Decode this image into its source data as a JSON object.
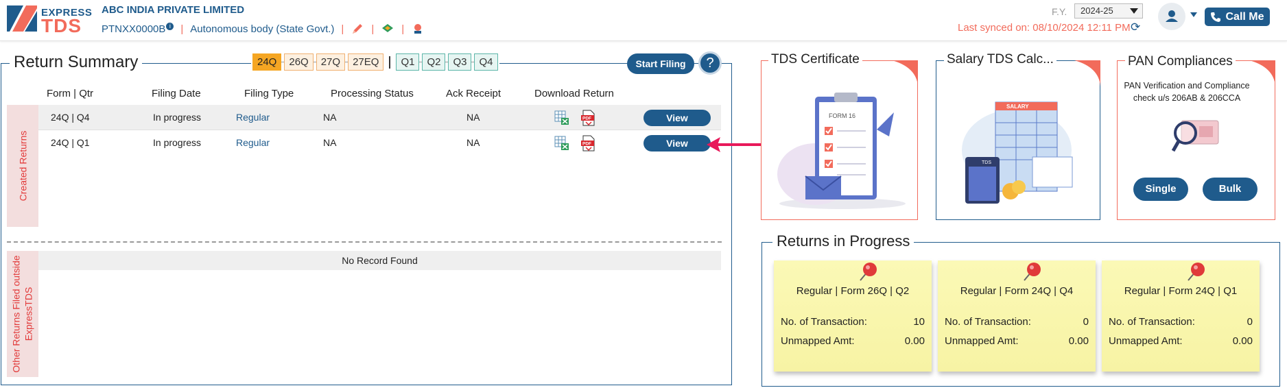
{
  "header": {
    "logo_top": "EXPRESS",
    "logo_bottom": "TDS",
    "company_name": "ABC INDIA PRIVATE LIMITED",
    "pan": "PTNXX0000B",
    "entity_type": "Autonomous body (State Govt.)",
    "fy_label": "F.Y.",
    "fy_value": "2024-25",
    "last_synced": "Last synced on: 08/10/2024 12:11 PM",
    "call_me": "Call Me"
  },
  "return_summary": {
    "title": "Return Summary",
    "tabs": [
      "24Q",
      "26Q",
      "27Q",
      "27EQ"
    ],
    "quarters": [
      "Q1",
      "Q2",
      "Q3",
      "Q4"
    ],
    "active_tab": "24Q",
    "start_filing": "Start Filing",
    "help": "?",
    "columns": [
      "Form | Qtr",
      "Filing Date",
      "Filing Type",
      "Processing Status",
      "Ack Receipt",
      "Download Return"
    ],
    "created_label": "Created Returns",
    "rows": [
      {
        "form_qtr": "24Q | Q4",
        "filing_date": "In progress",
        "filing_type": "Regular",
        "processing_status": "NA",
        "ack_receipt": "NA",
        "action": "View"
      },
      {
        "form_qtr": "24Q | Q1",
        "filing_date": "In progress",
        "filing_type": "Regular",
        "processing_status": "NA",
        "ack_receipt": "NA",
        "action": "View"
      }
    ],
    "other_label_line1": "Other Returns Filed outside",
    "other_label_line2": "ExpressTDS",
    "no_record": "No Record Found"
  },
  "cards": {
    "tds_certificate": {
      "title": "TDS Certificate",
      "form_label": "FORM 16"
    },
    "salary_calc": {
      "title": "Salary TDS Calc...",
      "salary_label": "SALARY",
      "tds_label": "TDS"
    },
    "pan_compliances": {
      "title": "PAN Compliances",
      "description_line1": "PAN Verification and Compliance",
      "description_line2": "check u/s 206AB & 206CCA",
      "single": "Single",
      "bulk": "Bulk"
    }
  },
  "returns_in_progress": {
    "title": "Returns in Progress",
    "transaction_label": "No. of Transaction:",
    "unmapped_label": "Unmapped Amt:",
    "notes": [
      {
        "title": "Regular | Form 26Q | Q2",
        "transactions": "10",
        "unmapped": "0.00"
      },
      {
        "title": "Regular | Form 24Q | Q4",
        "transactions": "0",
        "unmapped": "0.00"
      },
      {
        "title": "Regular | Form 24Q | Q1",
        "transactions": "0",
        "unmapped": "0.00"
      }
    ]
  },
  "colors": {
    "primary": "#1f5b8c",
    "accent": "#f26b5b",
    "active_tab": "#f5a623",
    "note": "#f7f3a4"
  }
}
